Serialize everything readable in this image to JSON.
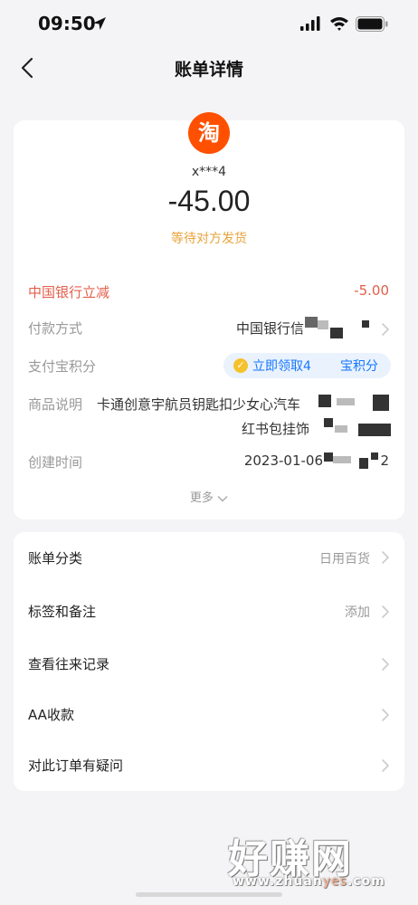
{
  "status_bar": {
    "time": "09:50"
  },
  "nav": {
    "title": "账单详情"
  },
  "bill": {
    "merchant_logo_text": "淘",
    "merchant_name": "x***4",
    "amount": "-45.00",
    "status": "等待对方发货"
  },
  "details": {
    "discount_label": "中国银行立减",
    "discount_value": "-5.00",
    "payment_label": "付款方式",
    "payment_value": "中国银行信",
    "points_label": "支付宝积分",
    "points_button": "立即领取4",
    "points_button_tail": "宝积分",
    "desc_label": "商品说明",
    "desc_line1": "卡通创意宇航员钥匙扣少女心汽车",
    "desc_line2": "红书包挂饰",
    "created_label": "创建时间",
    "created_value": "2023-01-06",
    "created_tail": "2",
    "more": "更多"
  },
  "menu": [
    {
      "label": "账单分类",
      "value": "日用百货"
    },
    {
      "label": "标签和备注",
      "value": "添加"
    },
    {
      "label": "查看往来记录",
      "value": ""
    },
    {
      "label": "AA收款",
      "value": ""
    },
    {
      "label": "对此订单有疑问",
      "value": ""
    }
  ],
  "watermark": {
    "logo": "好赚网",
    "url_a": "www.zhuan",
    "url_b": "yes",
    "url_c": ".com"
  },
  "colors": {
    "accent_red": "#e35f4b",
    "status_orange": "#e8a33b",
    "taobao_orange": "#ff5000",
    "link_blue": "#1677ff"
  }
}
